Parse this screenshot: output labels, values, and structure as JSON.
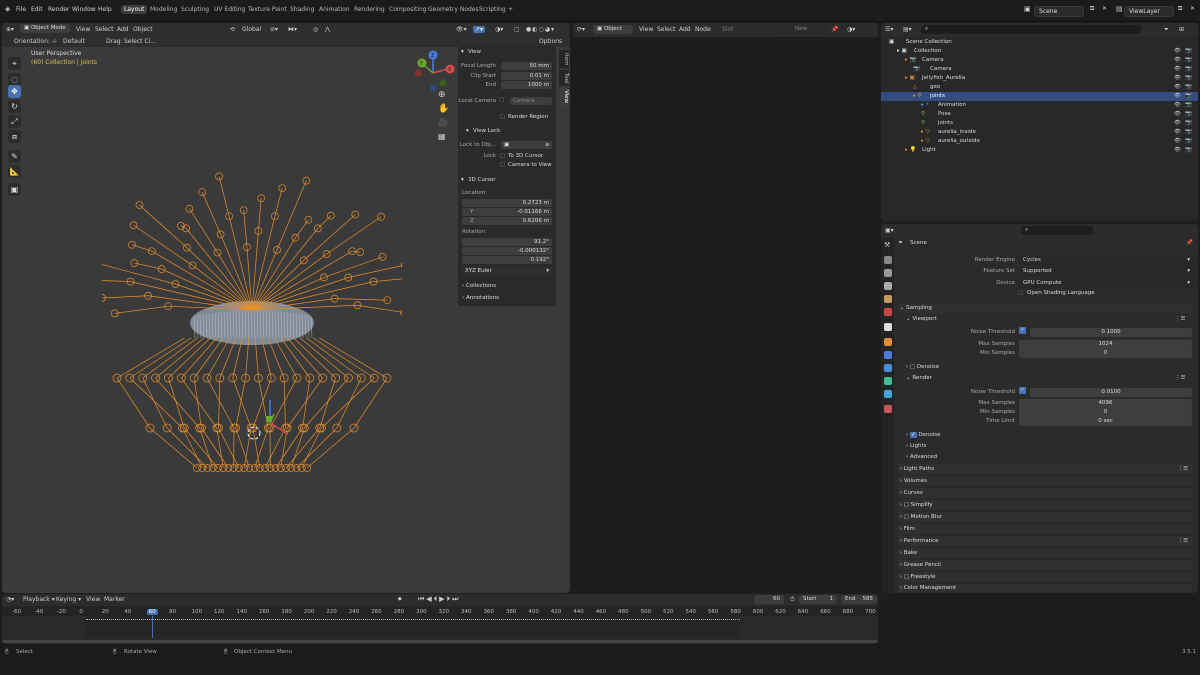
{
  "topbar": {
    "menus": [
      "File",
      "Edit",
      "Render",
      "Window",
      "Help"
    ],
    "tabs": [
      "Layout",
      "Modeling",
      "Sculpting",
      "UV Editing",
      "Texture Paint",
      "Shading",
      "Animation",
      "Rendering",
      "Compositing",
      "Geometry Nodes",
      "Scripting"
    ],
    "add_tab": "+",
    "scene": "Scene",
    "view_layer": "ViewLayer"
  },
  "viewport": {
    "mode": "Object Mode",
    "menus": [
      "View",
      "Select",
      "Add",
      "Object"
    ],
    "transform": "Global",
    "orientation_label": "Orientation:",
    "orientation": "Default",
    "drag_label": "Drag:",
    "drag": "Select Ci...",
    "options": "Options",
    "perspective": "User Perspective",
    "collection": "(60) Collection | joints",
    "gizmo_x": "X",
    "gizmo_y": "Y",
    "gizmo_z": "Z"
  },
  "npanel": {
    "view_title": "View",
    "focal_length_label": "Focal Length",
    "focal_length": "50 mm",
    "clip_start_label": "Clip Start",
    "clip_start": "0.01 m",
    "end_label": "End",
    "clip_end": "1000 m",
    "local_camera_label": "Local Camera",
    "local_camera": "Camera",
    "render_region": "Render Region",
    "view_lock_title": "View Lock",
    "lock_to_obj_label": "Lock to Obj...",
    "lock_label": "Lock",
    "to_3d_cursor": "To 3D Cursor",
    "camera_to_view": "Camera to View",
    "cursor_title": "3D Cursor",
    "location_label": "Location:",
    "x_label": "X",
    "y_label": "Y",
    "z_label": "Z",
    "loc_x": "0.2723 m",
    "loc_y": "-0.01166 m",
    "loc_z": "0.6206 m",
    "rotation_label": "Rotation:",
    "rot_x": "91.2°",
    "rot_y": "-0.000132°",
    "rot_z": "0.192°",
    "rotation_mode": "XYZ Euler",
    "collections": "Collections",
    "annotations": "Annotations",
    "tabs": [
      "Item",
      "Tool",
      "View"
    ]
  },
  "node_editor": {
    "mode": "Object",
    "menus": [
      "View",
      "Select",
      "Add",
      "Node"
    ],
    "slot": "Slot",
    "new": "New"
  },
  "outliner": {
    "rows": [
      {
        "label": "Scene Collection",
        "indent": 0
      },
      {
        "label": "Collection",
        "indent": 1
      },
      {
        "label": "Camera",
        "indent": 2
      },
      {
        "label": "Camera",
        "indent": 3
      },
      {
        "label": "Jellyfish_Aurelia",
        "indent": 2
      },
      {
        "label": "geo",
        "indent": 3
      },
      {
        "label": "joints",
        "indent": 3,
        "selected": true
      },
      {
        "label": "Animation",
        "indent": 4
      },
      {
        "label": "Pose",
        "indent": 4
      },
      {
        "label": "joints",
        "indent": 4
      },
      {
        "label": "aurelia_inside",
        "indent": 4
      },
      {
        "label": "aurelia_outside",
        "indent": 4
      },
      {
        "label": "Light",
        "indent": 2
      }
    ]
  },
  "properties": {
    "context": "Scene",
    "render_engine_label": "Render Engine",
    "render_engine": "Cycles",
    "feature_set_label": "Feature Set",
    "feature_set": "Supported",
    "device_label": "Device",
    "device": "GPU Compute",
    "osl": "Open Shading Language",
    "sampling": "Sampling",
    "viewport": "Viewport",
    "noise_threshold_label": "Noise Threshold",
    "vp_noise": "0.1000",
    "max_samples_label": "Max Samples",
    "vp_max": "1024",
    "min_samples_label": "Min Samples",
    "vp_min": "0",
    "denoise": "Denoise",
    "render": "Render",
    "r_noise": "0.0100",
    "r_max": "4096",
    "r_min": "0",
    "time_limit_label": "Time Limit",
    "time_limit": "0 sec",
    "lights": "Lights",
    "advanced": "Advanced",
    "light_paths": "Light Paths",
    "volumes": "Volumes",
    "curves": "Curves",
    "simplify": "Simplify",
    "motion_blur": "Motion Blur",
    "film": "Film",
    "performance": "Performance",
    "bake": "Bake",
    "grease_pencil": "Grease Pencil",
    "freestyle": "Freestyle",
    "color_management": "Color Management"
  },
  "timeline": {
    "menus": [
      "Playback",
      "Keying",
      "View",
      "Marker"
    ],
    "current_frame": "60",
    "start_label": "Start",
    "start": "1",
    "end_label": "End",
    "end": "585",
    "ticks": [
      "-60",
      "-40",
      "-20",
      "0",
      "20",
      "40",
      "60",
      "80",
      "100",
      "120",
      "140",
      "160",
      "180",
      "200",
      "220",
      "240",
      "260",
      "280",
      "300",
      "320",
      "340",
      "360",
      "380",
      "400",
      "420",
      "440",
      "460",
      "480",
      "500",
      "520",
      "540",
      "560",
      "580",
      "600",
      "620",
      "640",
      "660",
      "680",
      "700"
    ]
  },
  "status": {
    "select": "Select",
    "rotate": "Rotate View",
    "context_menu": "Object Context Menu",
    "version": "3.5.1"
  }
}
